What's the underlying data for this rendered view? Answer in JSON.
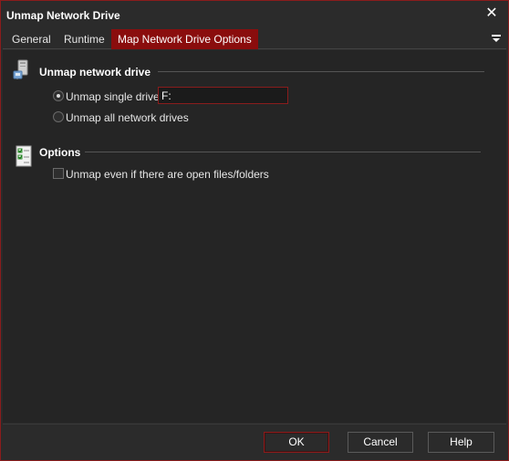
{
  "window": {
    "title": "Unmap Network Drive",
    "close_glyph": "✕"
  },
  "tabs": [
    {
      "label": "General"
    },
    {
      "label": "Runtime"
    },
    {
      "label": "Map Network Drive Options"
    }
  ],
  "tab_menu_icon": "hamburger-icon",
  "section_unmap": {
    "title": "Unmap network drive",
    "icon": "network-drive-icon",
    "single": {
      "label": "Unmap single drive",
      "checked": true
    },
    "all": {
      "label": "Unmap all network drives",
      "checked": false
    },
    "drive_value": "F:"
  },
  "section_options": {
    "title": "Options",
    "icon": "checklist-icon",
    "open_files": {
      "label": "Unmap even if there are open files/folders",
      "checked": false
    }
  },
  "buttons": {
    "ok": "OK",
    "cancel": "Cancel",
    "help": "Help"
  },
  "colors": {
    "accent": "#8a0d0d",
    "background": "#2b2b2b",
    "panel": "#252525"
  }
}
